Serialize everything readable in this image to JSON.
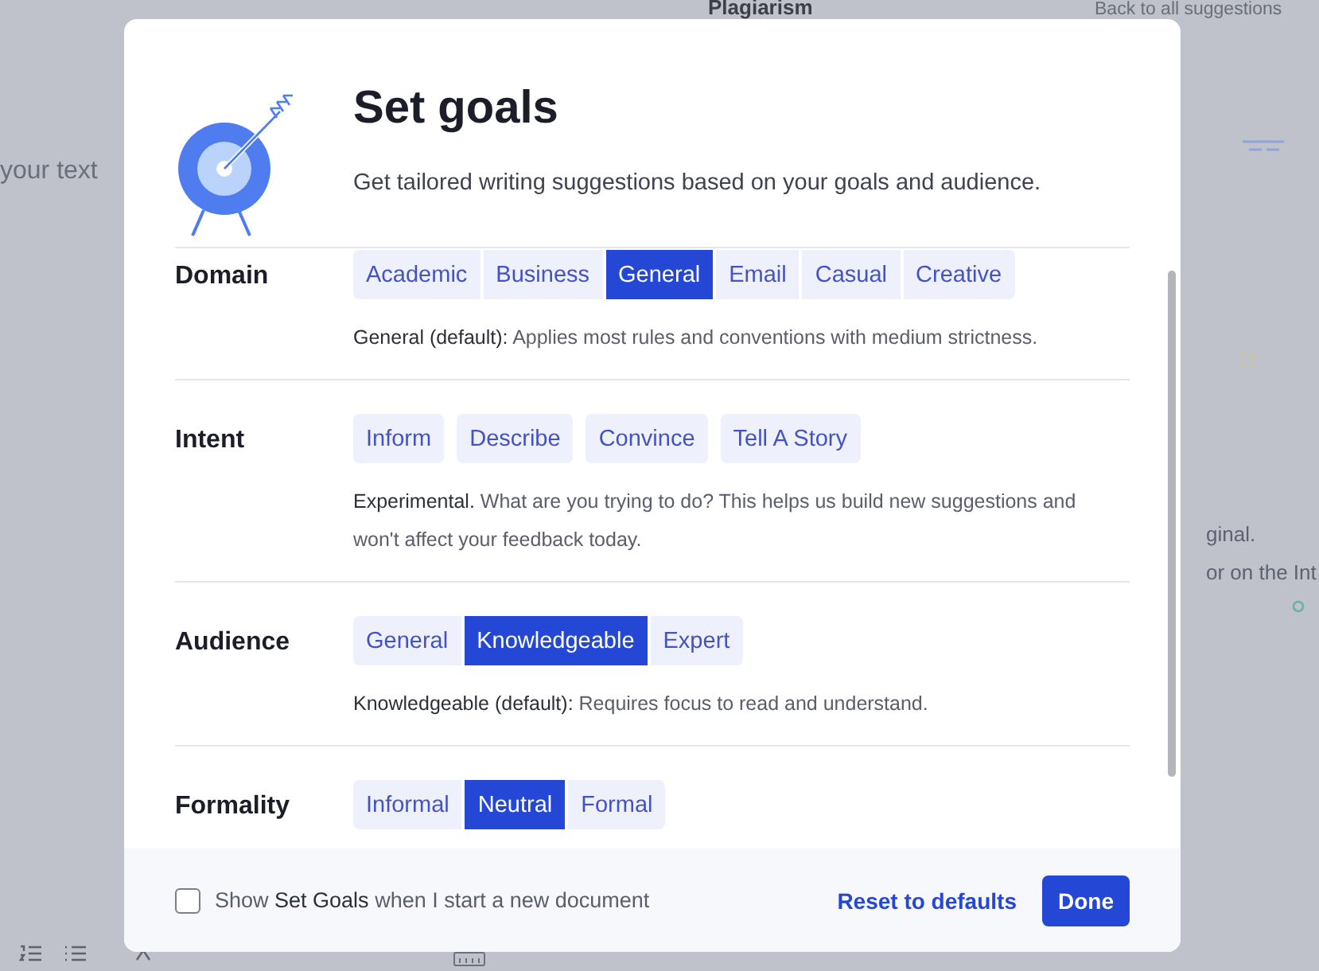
{
  "background": {
    "texts": [
      {
        "kind": "heading",
        "text": "Plagiarism"
      },
      {
        "kind": "link",
        "text": "Back to all suggestions"
      },
      {
        "kind": "placeholder",
        "text": "your text"
      },
      {
        "kind": "body",
        "text": "ginal."
      },
      {
        "kind": "body",
        "text": "or on the Int"
      }
    ]
  },
  "dialog": {
    "title": "Set goals",
    "subtitle": "Get tailored writing suggestions based on your goals and audience.",
    "sections": [
      {
        "label": "Domain",
        "kind": "segmented",
        "options": [
          {
            "label": "Academic",
            "selected": false
          },
          {
            "label": "Business",
            "selected": false
          },
          {
            "label": "General",
            "selected": true
          },
          {
            "label": "Email",
            "selected": false
          },
          {
            "label": "Casual",
            "selected": false
          },
          {
            "label": "Creative",
            "selected": false
          }
        ],
        "description": "**General (default):** Applies most rules and conventions with medium strictness."
      },
      {
        "label": "Intent",
        "kind": "separate",
        "options": [
          {
            "label": "Inform",
            "selected": false
          },
          {
            "label": "Describe",
            "selected": false
          },
          {
            "label": "Convince",
            "selected": false
          },
          {
            "label": "Tell A Story",
            "selected": false
          }
        ],
        "description": "**Experimental.** What are you trying to do? This helps us build new suggestions and won't affect your feedback today."
      },
      {
        "label": "Audience",
        "kind": "segmented",
        "options": [
          {
            "label": "General",
            "selected": false
          },
          {
            "label": "Knowledgeable",
            "selected": true
          },
          {
            "label": "Expert",
            "selected": false
          }
        ],
        "description": "**Knowledgeable (default):** Requires focus to read and understand."
      },
      {
        "label": "Formality",
        "kind": "segmented",
        "options": [
          {
            "label": "Informal",
            "selected": false
          },
          {
            "label": "Neutral",
            "selected": true
          },
          {
            "label": "Formal",
            "selected": false
          }
        ]
      }
    ],
    "footer": {
      "checkbox": {
        "label": "Show **Set Goals** when I start a new document",
        "checked": false
      },
      "reset": "Reset to defaults",
      "done": "Done"
    }
  }
}
